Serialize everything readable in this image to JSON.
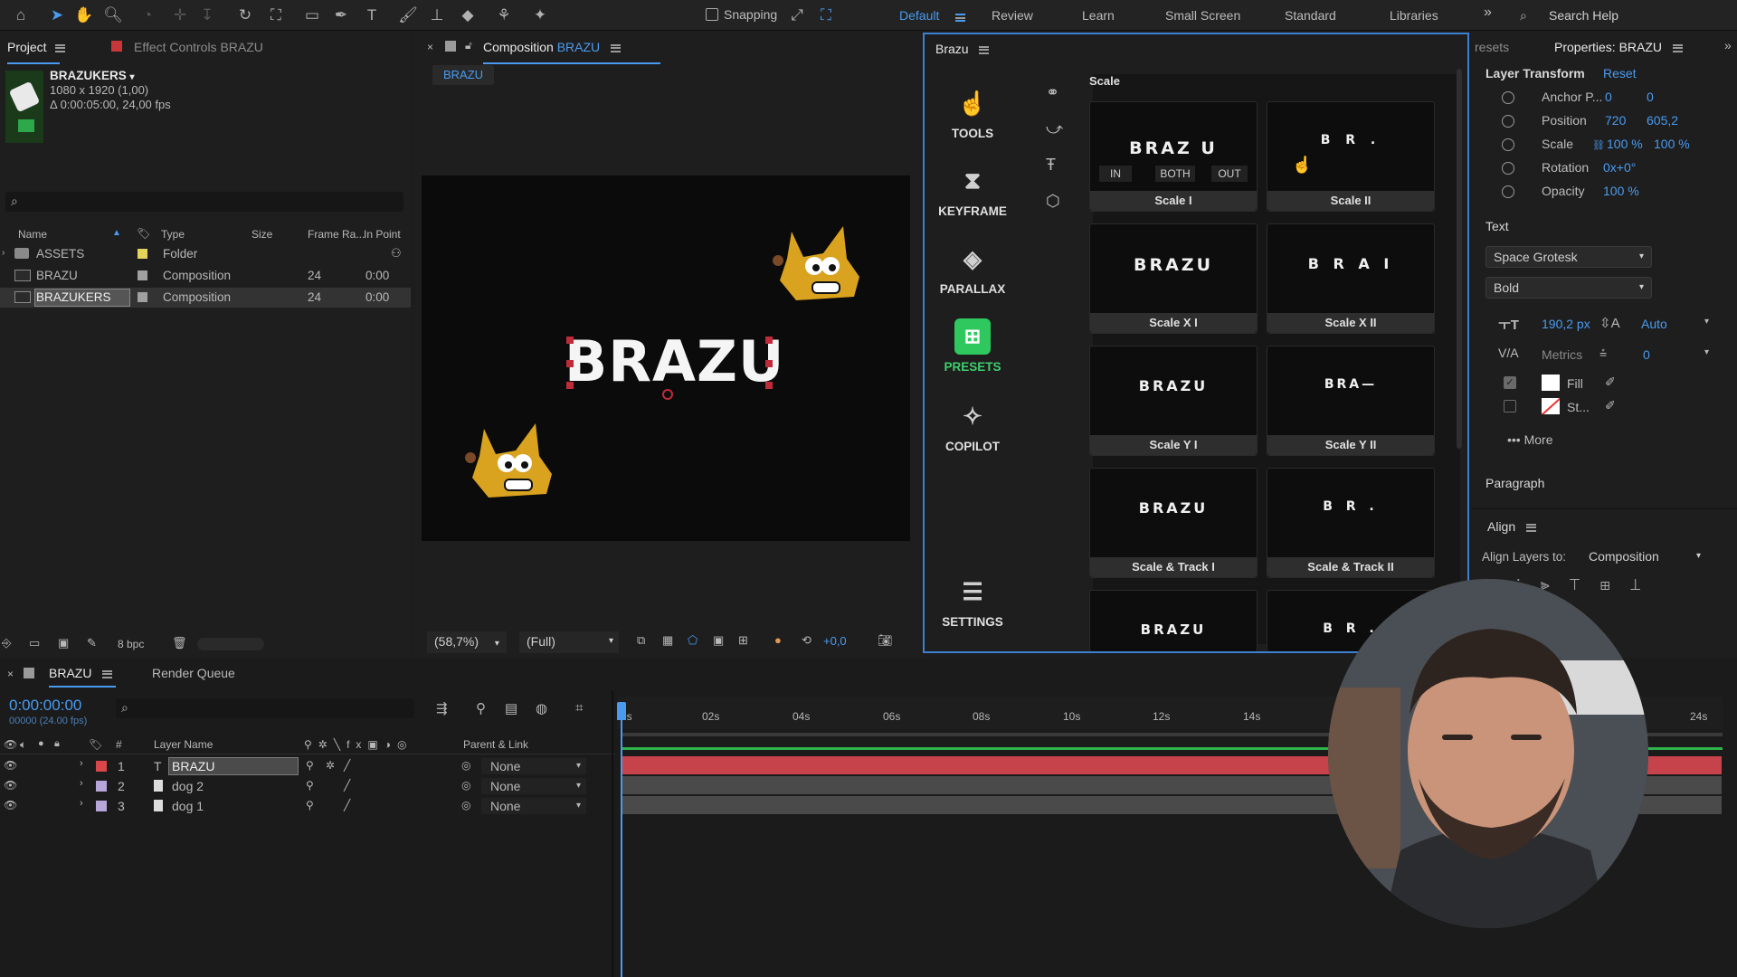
{
  "toolbar": {
    "snapping_label": "Snapping",
    "workspaces": [
      "Default",
      "Review",
      "Learn",
      "Small Screen",
      "Standard",
      "Libraries"
    ],
    "search_placeholder": "Search Help"
  },
  "project": {
    "tab_project": "Project",
    "tab_effects": "Effect Controls BRAZU",
    "item_name": "BRAZUKERS",
    "item_dims": "1080 x 1920 (1,00)",
    "item_duration": "Δ 0:00:05:00, 24,00 fps",
    "columns": [
      "Name",
      "Type",
      "Size",
      "Frame Ra...",
      "In Point"
    ],
    "rows": [
      {
        "name": "ASSETS",
        "type": "Folder",
        "fps": "",
        "in": "",
        "color": "#e3d35a"
      },
      {
        "name": "BRAZU",
        "type": "Composition",
        "fps": "24",
        "in": "0:00",
        "color": "#a0a0a0"
      },
      {
        "name": "BRAZUKERS",
        "type": "Composition",
        "fps": "24",
        "in": "0:00",
        "color": "#a0a0a0"
      }
    ],
    "bpc": "8 bpc"
  },
  "composition": {
    "tab_label": "Composition",
    "tab_name": "BRAZU",
    "breadcrumb": "BRAZU",
    "text": "BRAZU",
    "zoom": "(58,7%)",
    "quality": "(Full)",
    "exposure": "+0,0"
  },
  "brazu": {
    "panel_title": "Brazu",
    "section": "Scale",
    "nav": [
      {
        "label": "TOOLS",
        "icon": "hand-icon"
      },
      {
        "label": "KEYFRAME",
        "icon": "hourglass-icon"
      },
      {
        "label": "PARALLAX",
        "icon": "layers-icon"
      },
      {
        "label": "PRESETS",
        "icon": "presets-icon"
      },
      {
        "label": "COPILOT",
        "icon": "copilot-icon"
      },
      {
        "label": "SETTINGS",
        "icon": "sliders-icon"
      }
    ],
    "scale_buttons": [
      "IN",
      "BOTH",
      "OUT"
    ],
    "presets": [
      {
        "label": "Scale I",
        "preview": "BRAZ U"
      },
      {
        "label": "Scale II",
        "preview": "B R ."
      },
      {
        "label": "Scale X I",
        "preview": "BRAZU"
      },
      {
        "label": "Scale X II",
        "preview": "B R A I"
      },
      {
        "label": "Scale Y I",
        "preview": "BRAZU"
      },
      {
        "label": "Scale Y II",
        "preview": "BRA—"
      },
      {
        "label": "Scale & Track I",
        "preview": "BRAZU"
      },
      {
        "label": "Scale & Track II",
        "preview": "B R ."
      },
      {
        "label": "",
        "preview": "BRAZU"
      },
      {
        "label": "",
        "preview": "B R ."
      }
    ]
  },
  "properties": {
    "tab_presets": "resets",
    "tab_properties": "Properties: BRAZU",
    "layer_transform": "Layer Transform",
    "reset": "Reset",
    "transform": [
      {
        "label": "Anchor P...",
        "v1": "0",
        "v2": "0"
      },
      {
        "label": "Position",
        "v1": "720",
        "v2": "605,2"
      },
      {
        "label": "Scale",
        "v1": "100 %",
        "v2": "100 %"
      },
      {
        "label": "Rotation",
        "v1": "0x+0°",
        "v2": ""
      },
      {
        "label": "Opacity",
        "v1": "100 %",
        "v2": ""
      }
    ],
    "text_section": "Text",
    "font": "Space Grotesk",
    "weight": "Bold",
    "font_size": "190,2 px",
    "leading": "Auto",
    "kerning": "Metrics",
    "tracking": "0",
    "fill_label": "Fill",
    "stroke_label": "St...",
    "more": "More",
    "paragraph": "Paragraph",
    "align": "Align",
    "align_to_label": "Align Layers to:",
    "align_to": "Composition"
  },
  "timeline": {
    "tab": "BRAZU",
    "render_queue": "Render Queue",
    "timecode": "0:00:00:00",
    "frame_info": "00000 (24.00 fps)",
    "col_layer": "Layer Name",
    "col_parent": "Parent & Link",
    "ruler": [
      "0s",
      "02s",
      "04s",
      "06s",
      "08s",
      "10s",
      "12s",
      "14s",
      "24s"
    ],
    "layers": [
      {
        "num": "1",
        "type": "T",
        "name": "BRAZU",
        "parent": "None",
        "color": "#d9474a"
      },
      {
        "num": "2",
        "type": "",
        "name": "dog 2",
        "parent": "None",
        "color": "#b7a6d9"
      },
      {
        "num": "3",
        "type": "",
        "name": "dog 1",
        "parent": "None",
        "color": "#b7a6d9"
      }
    ]
  }
}
